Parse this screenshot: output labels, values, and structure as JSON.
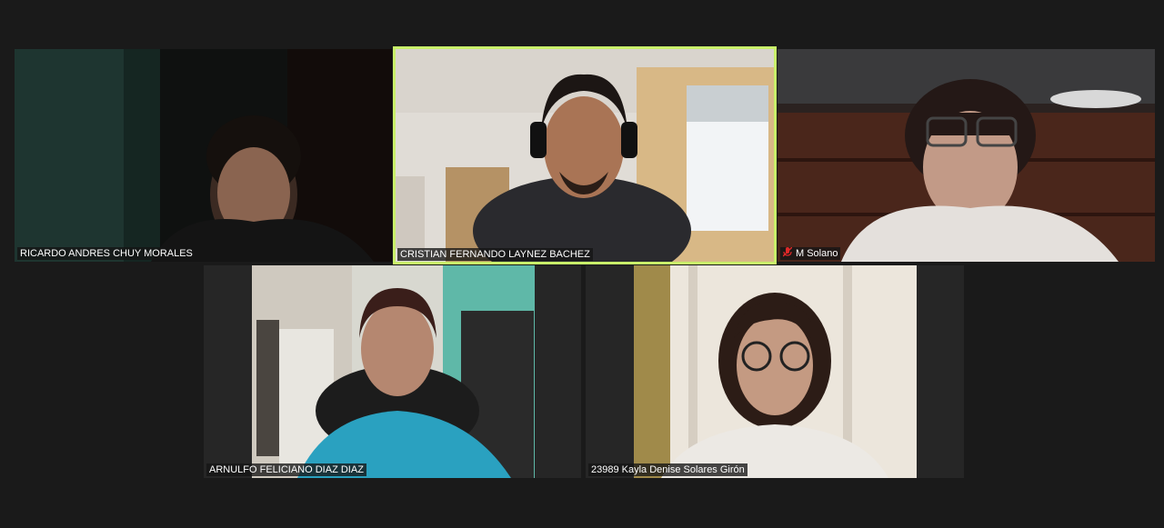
{
  "participants": [
    {
      "name": "RICARDO ANDRES CHUY MORALES",
      "muted": false,
      "speaking": false
    },
    {
      "name": "CRISTIAN FERNANDO LAYNEZ BACHEZ",
      "muted": false,
      "speaking": true
    },
    {
      "name": "M Solano",
      "muted": true,
      "speaking": false
    },
    {
      "name": "ARNULFO FELICIANO DIAZ DIAZ",
      "muted": false,
      "speaking": false
    },
    {
      "name": "23989 Kayla Denise Solares Girón",
      "muted": false,
      "speaking": false
    }
  ],
  "colors": {
    "background": "#1a1a1a",
    "tile": "#262626",
    "active_speaker_border": "#c9f06a",
    "muted_icon": "#e02828"
  }
}
